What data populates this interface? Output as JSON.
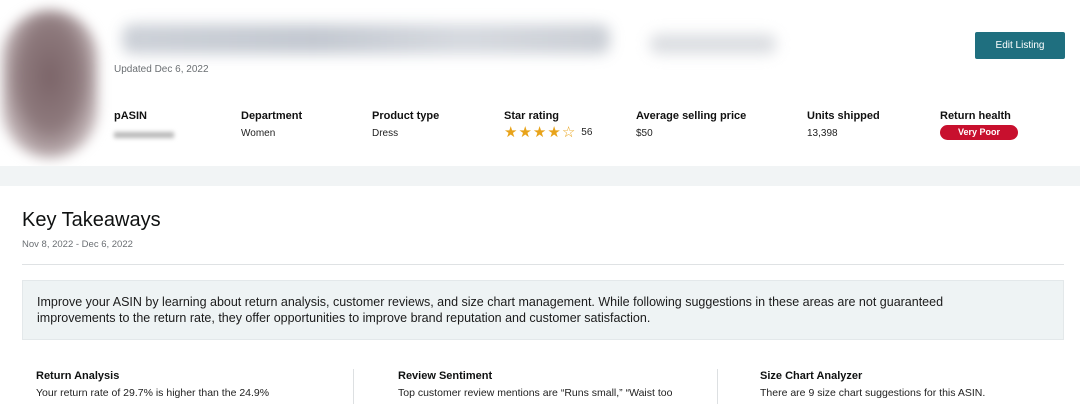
{
  "header": {
    "updated": "Updated Dec 6, 2022",
    "edit_button": "Edit Listing"
  },
  "details": {
    "pasin_label": "pASIN",
    "department_label": "Department",
    "department_value": "Women",
    "product_type_label": "Product type",
    "product_type_value": "Dress",
    "star_rating_label": "Star rating",
    "star_rating_value": 3.5,
    "star_rating_count": "56",
    "avg_price_label": "Average selling price",
    "avg_price_value": "$50",
    "units_label": "Units shipped",
    "units_value": "13,398",
    "return_health_label": "Return health",
    "return_health_value": "Very Poor",
    "return_health_color": "#c8102e"
  },
  "takeaways": {
    "title": "Key Takeaways",
    "date_range": "Nov 8, 2022 - Dec 6, 2022",
    "info_line1": "Improve your ASIN by learning about return analysis, customer reviews, and size chart management. While following suggestions in these areas are not guaranteed",
    "info_line2": "improvements to the return rate, they offer opportunities to improve brand reputation and customer satisfaction."
  },
  "cards": [
    {
      "title": "Return Analysis",
      "text": "Your return rate of 29.7% is higher than the 24.9%"
    },
    {
      "title": "Review Sentiment",
      "text": "Top customer review mentions are “Runs small,” “Waist too"
    },
    {
      "title": "Size Chart Analyzer",
      "text": "There are 9 size chart suggestions for this ASIN."
    }
  ],
  "colors": {
    "accent_button": "#1f6f7f",
    "star": "#e8a31a"
  }
}
